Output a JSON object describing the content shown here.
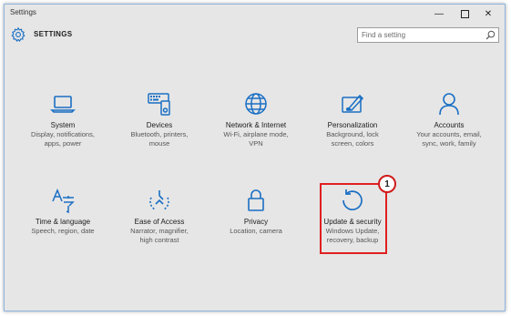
{
  "window": {
    "title": "Settings",
    "controls": {
      "minimize": "—",
      "close": "✕"
    }
  },
  "header": {
    "heading": "SETTINGS",
    "icon": "gear-icon",
    "search": {
      "placeholder": "Find a setting",
      "value": ""
    }
  },
  "colors": {
    "accent": "#1a6fc4",
    "highlight": "#e02020"
  },
  "tiles": [
    {
      "id": "system",
      "name": "System",
      "icon": "laptop-icon",
      "desc": "Display, notifications,\napps, power"
    },
    {
      "id": "devices",
      "name": "Devices",
      "icon": "keyboard-icon",
      "desc": "Bluetooth, printers,\nmouse"
    },
    {
      "id": "network",
      "name": "Network & Internet",
      "icon": "globe-icon",
      "desc": "Wi-Fi, airplane mode,\nVPN"
    },
    {
      "id": "personalization",
      "name": "Personalization",
      "icon": "paintbrush-icon",
      "desc": "Background, lock\nscreen, colors"
    },
    {
      "id": "accounts",
      "name": "Accounts",
      "icon": "person-icon",
      "desc": "Your accounts, email,\nsync, work, family"
    },
    {
      "id": "time",
      "name": "Time & language",
      "icon": "language-icon",
      "desc": "Speech, region, date"
    },
    {
      "id": "ease",
      "name": "Ease of Access",
      "icon": "ease-of-access-icon",
      "desc": "Narrator, magnifier,\nhigh contrast"
    },
    {
      "id": "privacy",
      "name": "Privacy",
      "icon": "lock-icon",
      "desc": "Location, camera"
    },
    {
      "id": "update",
      "name": "Update & security",
      "icon": "refresh-icon",
      "desc": "Windows Update,\nrecovery, backup"
    }
  ],
  "annotation": {
    "badge": "1"
  }
}
